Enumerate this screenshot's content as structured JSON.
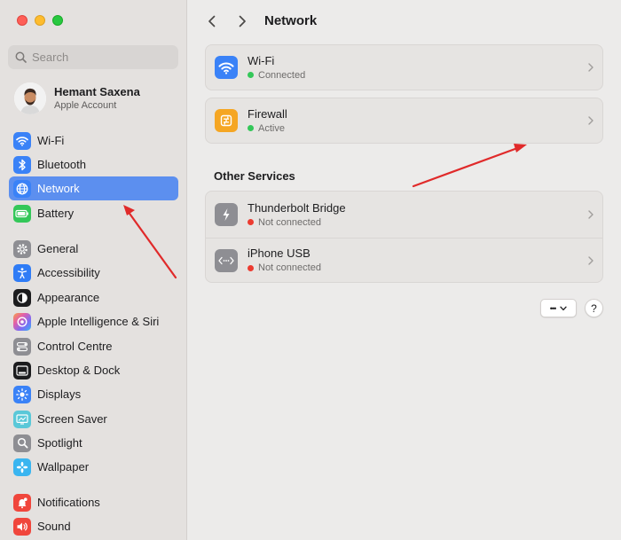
{
  "window": {
    "traffic_lights": [
      "close",
      "minimize",
      "zoom"
    ]
  },
  "search": {
    "placeholder": "Search"
  },
  "account": {
    "name": "Hemant Saxena",
    "subtitle": "Apple Account"
  },
  "sidebar": {
    "items": [
      {
        "label": "Wi-Fi",
        "icon": "wifi-icon",
        "color": "#3a82f7"
      },
      {
        "label": "Bluetooth",
        "icon": "bluetooth-icon",
        "color": "#3a82f7"
      },
      {
        "label": "Network",
        "icon": "globe-icon",
        "color": "#3a82f7",
        "selected": true
      },
      {
        "label": "Battery",
        "icon": "battery-icon",
        "color": "#34c759"
      },
      {
        "label": "General",
        "icon": "gear-icon",
        "color": "#8e8e93"
      },
      {
        "label": "Accessibility",
        "icon": "accessibility-icon",
        "color": "#2f7cf6"
      },
      {
        "label": "Appearance",
        "icon": "appearance-icon",
        "color": "#1c1c1e"
      },
      {
        "label": "Apple Intelligence & Siri",
        "icon": "siri-icon",
        "color": "#e35fa8"
      },
      {
        "label": "Control Centre",
        "icon": "control-centre-icon",
        "color": "#8e8e93"
      },
      {
        "label": "Desktop & Dock",
        "icon": "dock-icon",
        "color": "#1c1c1e"
      },
      {
        "label": "Displays",
        "icon": "displays-icon",
        "color": "#3a82f7"
      },
      {
        "label": "Screen Saver",
        "icon": "screen-saver-icon",
        "color": "#5ac8d8"
      },
      {
        "label": "Spotlight",
        "icon": "spotlight-icon",
        "color": "#8e8e93"
      },
      {
        "label": "Wallpaper",
        "icon": "wallpaper-icon",
        "color": "#3ab5f0"
      },
      {
        "label": "Notifications",
        "icon": "notifications-icon",
        "color": "#f0463c"
      },
      {
        "label": "Sound",
        "icon": "sound-icon",
        "color": "#f0463c"
      }
    ]
  },
  "header": {
    "title": "Network",
    "back_icon": "chevron-left-icon",
    "forward_icon": "chevron-right-icon"
  },
  "services": [
    {
      "title": "Wi-Fi",
      "status": "Connected",
      "status_color": "#34c759",
      "icon": "wifi-icon",
      "icon_color": "#3a82f7"
    },
    {
      "title": "Firewall",
      "status": "Active",
      "status_color": "#34c759",
      "icon": "firewall-icon",
      "icon_color": "#f5a623"
    }
  ],
  "other_services": {
    "title": "Other Services",
    "items": [
      {
        "title": "Thunderbolt Bridge",
        "status": "Not connected",
        "status_color": "#ec3b30",
        "icon": "thunderbolt-icon",
        "icon_color": "#8e8e93"
      },
      {
        "title": "iPhone USB",
        "status": "Not connected",
        "status_color": "#ec3b30",
        "icon": "usb-icon",
        "icon_color": "#8e8e93"
      }
    ]
  },
  "toolbar": {
    "more_label": "•••",
    "help_label": "?"
  },
  "annotations": {
    "arrow_color": "#e02a2a"
  }
}
